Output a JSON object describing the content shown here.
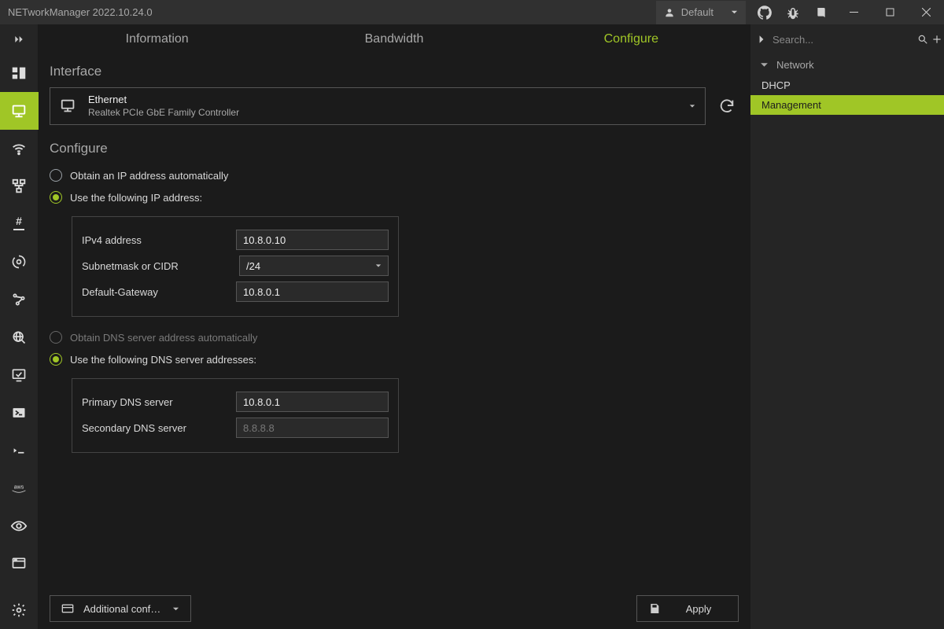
{
  "titlebar": {
    "title": "NETworkManager 2022.10.24.0",
    "profile_label": "Default"
  },
  "tabs": {
    "info": "Information",
    "bandwidth": "Bandwidth",
    "configure": "Configure"
  },
  "interface": {
    "heading": "Interface",
    "name": "Ethernet",
    "desc": "Realtek PCIe GbE Family Controller"
  },
  "configure": {
    "heading": "Configure",
    "ip_auto": "Obtain an IP address automatically",
    "ip_manual": "Use the following IP address:",
    "ipv4_label": "IPv4 address",
    "ipv4_value": "10.8.0.10",
    "subnet_label": "Subnetmask or CIDR",
    "subnet_value": "/24",
    "gateway_label": "Default-Gateway",
    "gateway_value": "10.8.0.1",
    "dns_auto": "Obtain DNS server address automatically",
    "dns_manual": "Use the following DNS server addresses:",
    "dns_primary_label": "Primary DNS server",
    "dns_primary_value": "10.8.0.1",
    "dns_secondary_label": "Secondary DNS server",
    "dns_secondary_placeholder": "8.8.8.8"
  },
  "footer": {
    "additional": "Additional config...",
    "apply": "Apply"
  },
  "right": {
    "search_placeholder": "Search...",
    "category": "Network",
    "items": [
      "DHCP",
      "Management"
    ],
    "dhcp": "DHCP",
    "management": "Management"
  },
  "icons": {
    "user": "user-icon",
    "github": "github-icon",
    "bug": "bug-icon",
    "book": "book-icon",
    "minimize": "minimize-icon",
    "maximize": "maximize-icon",
    "close": "close-icon"
  }
}
